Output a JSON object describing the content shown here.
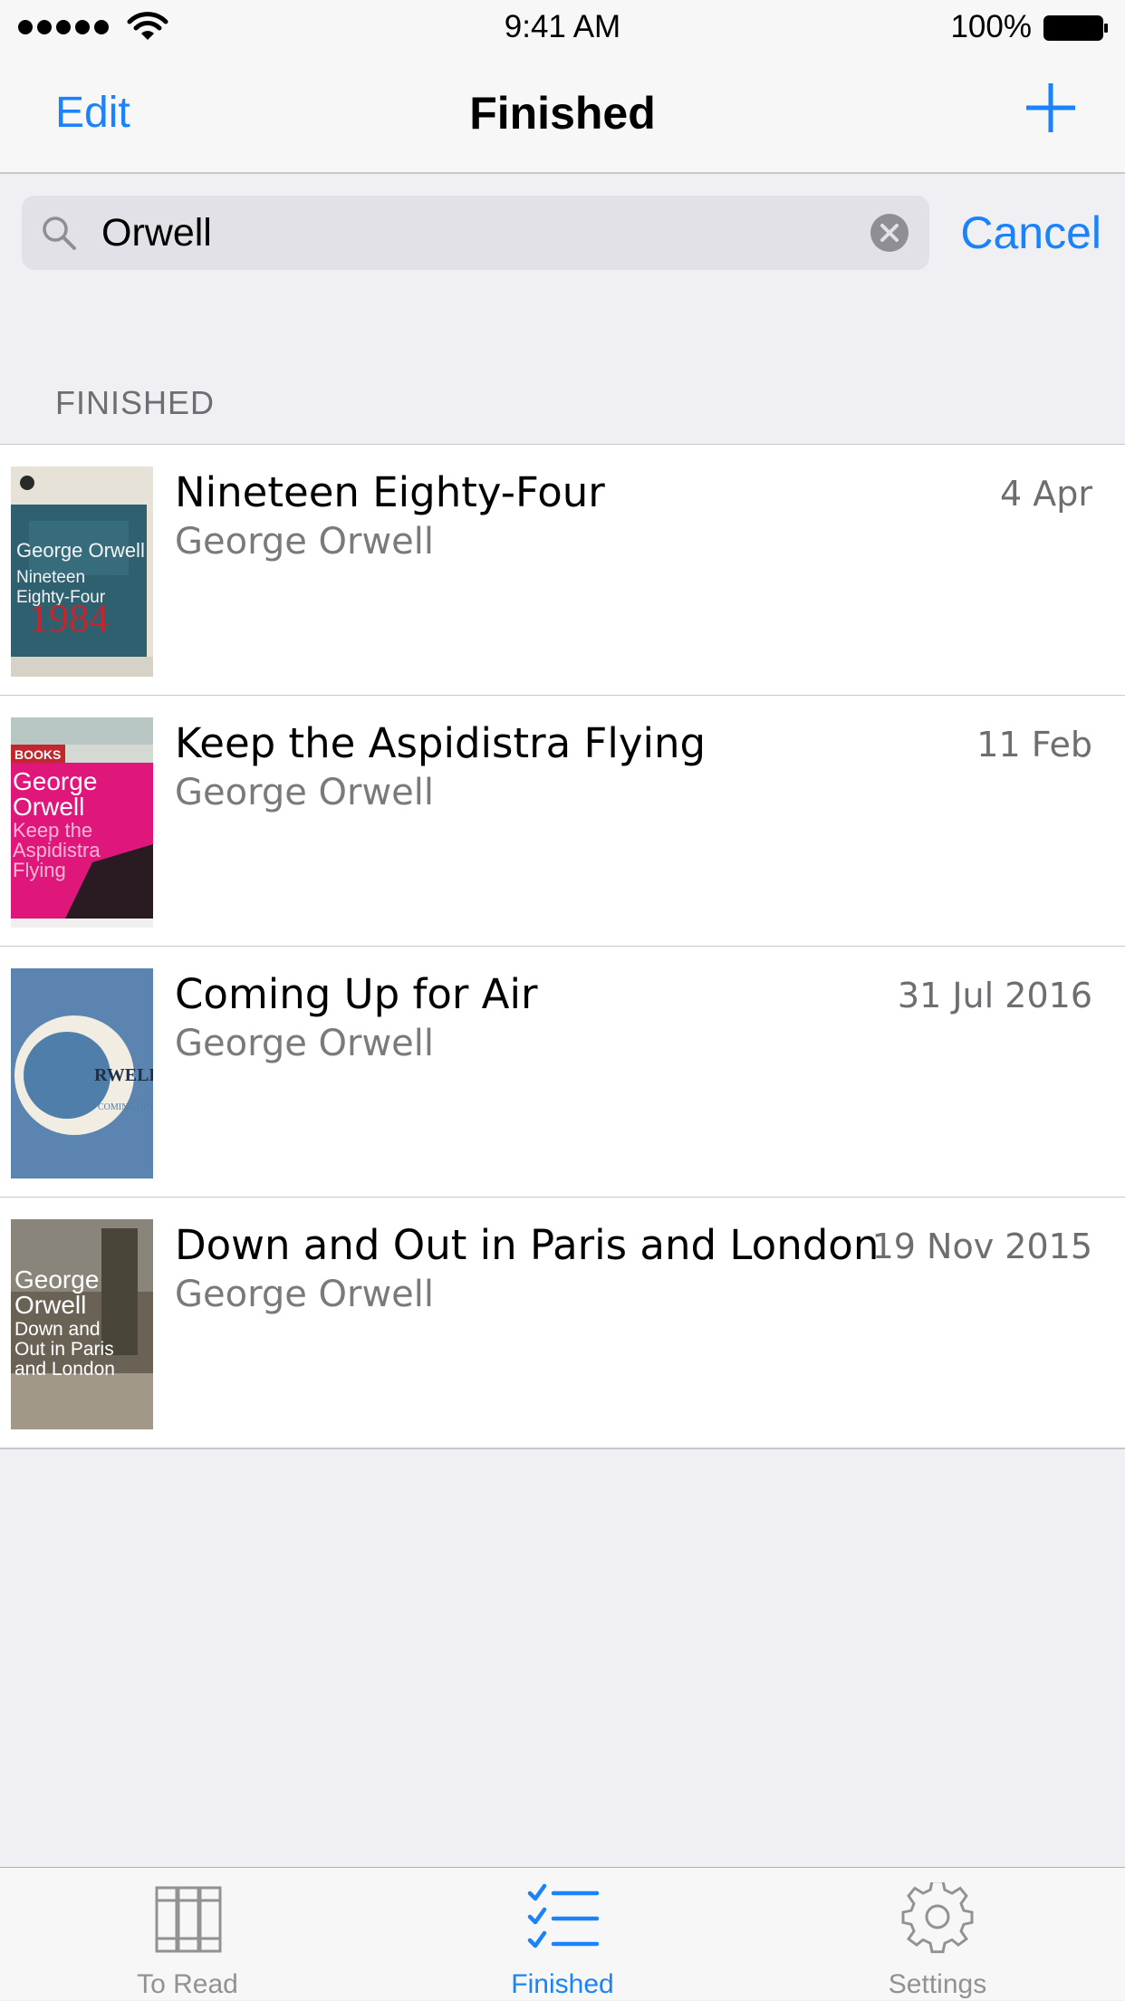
{
  "status_bar": {
    "time": "9:41 AM",
    "battery": "100%"
  },
  "nav": {
    "edit_label": "Edit",
    "title": "Finished",
    "add_icon": "plus-icon"
  },
  "search": {
    "value": "Orwell",
    "cancel_label": "Cancel"
  },
  "section_header": "FINISHED",
  "books": [
    {
      "title": "Nineteen Eighty-Four",
      "author": "George Orwell",
      "date": "4 Apr"
    },
    {
      "title": "Keep the Aspidistra Flying",
      "author": "George Orwell",
      "date": "11 Feb"
    },
    {
      "title": "Coming Up for Air",
      "author": "George Orwell",
      "date": "31 Jul 2016"
    },
    {
      "title": "Down and Out in Paris and London",
      "author": "George Orwell",
      "date": "19 Nov 2015"
    }
  ],
  "covers": {
    "c1": {
      "author": "George Orwell",
      "title1": "Nineteen",
      "title2": "Eighty-Four",
      "mark": "1984"
    },
    "c2": {
      "top": "BOOKS",
      "author1": "George",
      "author2": "Orwell",
      "title1": "Keep the",
      "title2": "Aspidistra",
      "title3": "Flying"
    },
    "c3": {
      "author": "RWELL",
      "title": "COMING UP FOR AIR"
    },
    "c4": {
      "author1": "George",
      "author2": "Orwell",
      "title1": "Down and",
      "title2": "Out in Paris",
      "title3": "and London"
    }
  },
  "tabs": [
    {
      "label": "To Read",
      "icon": "books-icon",
      "active": false
    },
    {
      "label": "Finished",
      "icon": "checklist-icon",
      "active": true
    },
    {
      "label": "Settings",
      "icon": "gear-icon",
      "active": false
    }
  ],
  "colors": {
    "accent": "#1a82fb",
    "background": "#efeff4",
    "bar": "#f7f7f7"
  }
}
